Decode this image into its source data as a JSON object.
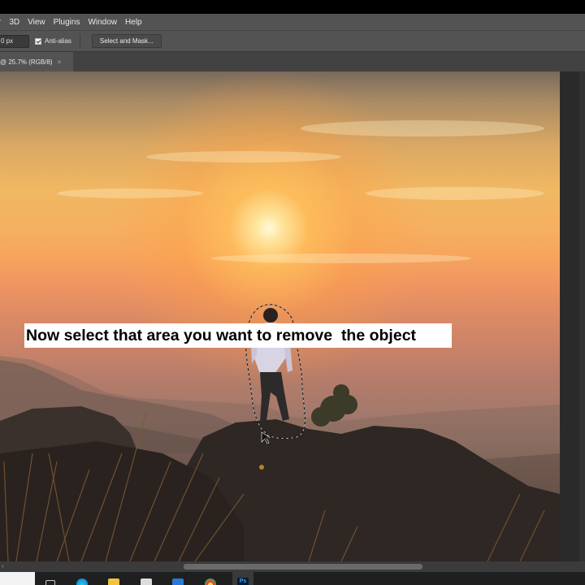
{
  "menubar": {
    "items": [
      "r",
      "3D",
      "View",
      "Plugins",
      "Window",
      "Help"
    ]
  },
  "options_bar": {
    "feather_value": "0 px",
    "anti_alias_label": "Anti-alias",
    "anti_alias_checked": true,
    "select_and_mask_label": "Select and Mask..."
  },
  "document_tab": {
    "title": "@ 25.7% (RGB/8)",
    "close_glyph": "×"
  },
  "canvas": {
    "caption": "Now select that area you want to remove  the object"
  },
  "taskbar": {
    "icons": [
      "task-view-icon",
      "edge-icon",
      "file-explorer-icon",
      "store-icon",
      "mail-icon",
      "chrome-icon",
      "photoshop-icon"
    ],
    "photoshop_label": "Ps"
  },
  "colors": {
    "menubar_bg": "#535353",
    "tabbar_bg": "#424242",
    "taskbar_bg": "#1f1f1f"
  }
}
